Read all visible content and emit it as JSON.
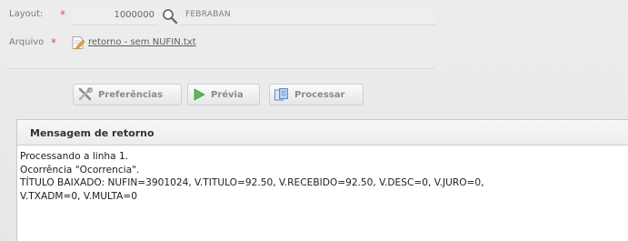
{
  "form": {
    "layout": {
      "label": "Layout:",
      "required_mark": "*",
      "code_value": "1000000",
      "description_value": "FEBRABAN"
    },
    "arquivo": {
      "label": "Arquivo",
      "required_mark": "*",
      "file_name": "retorno - sem NUFIN.txt"
    }
  },
  "toolbar": {
    "preferences_label": "Preferências",
    "preview_label": "Prévia",
    "process_label": "Processar"
  },
  "message_panel": {
    "title": "Mensagem de retorno",
    "lines": [
      "Processando a linha 1.",
      "Ocorrência \"Ocorrencia\".",
      "TÍTULO BAIXADO: NUFIN=3901024, V.TITULO=92.50, V.RECEBIDO=92.50, V.DESC=0, V.JURO=0,",
      "V.TXADM=0, V.MULTA=0"
    ]
  },
  "colors": {
    "required": "#e0524e",
    "preview_icon": "#5cb85c",
    "process_icon": "#5b8cc8"
  },
  "icons": [
    "search-icon",
    "file-edit-icon",
    "tools-icon",
    "play-icon",
    "process-icon"
  ]
}
